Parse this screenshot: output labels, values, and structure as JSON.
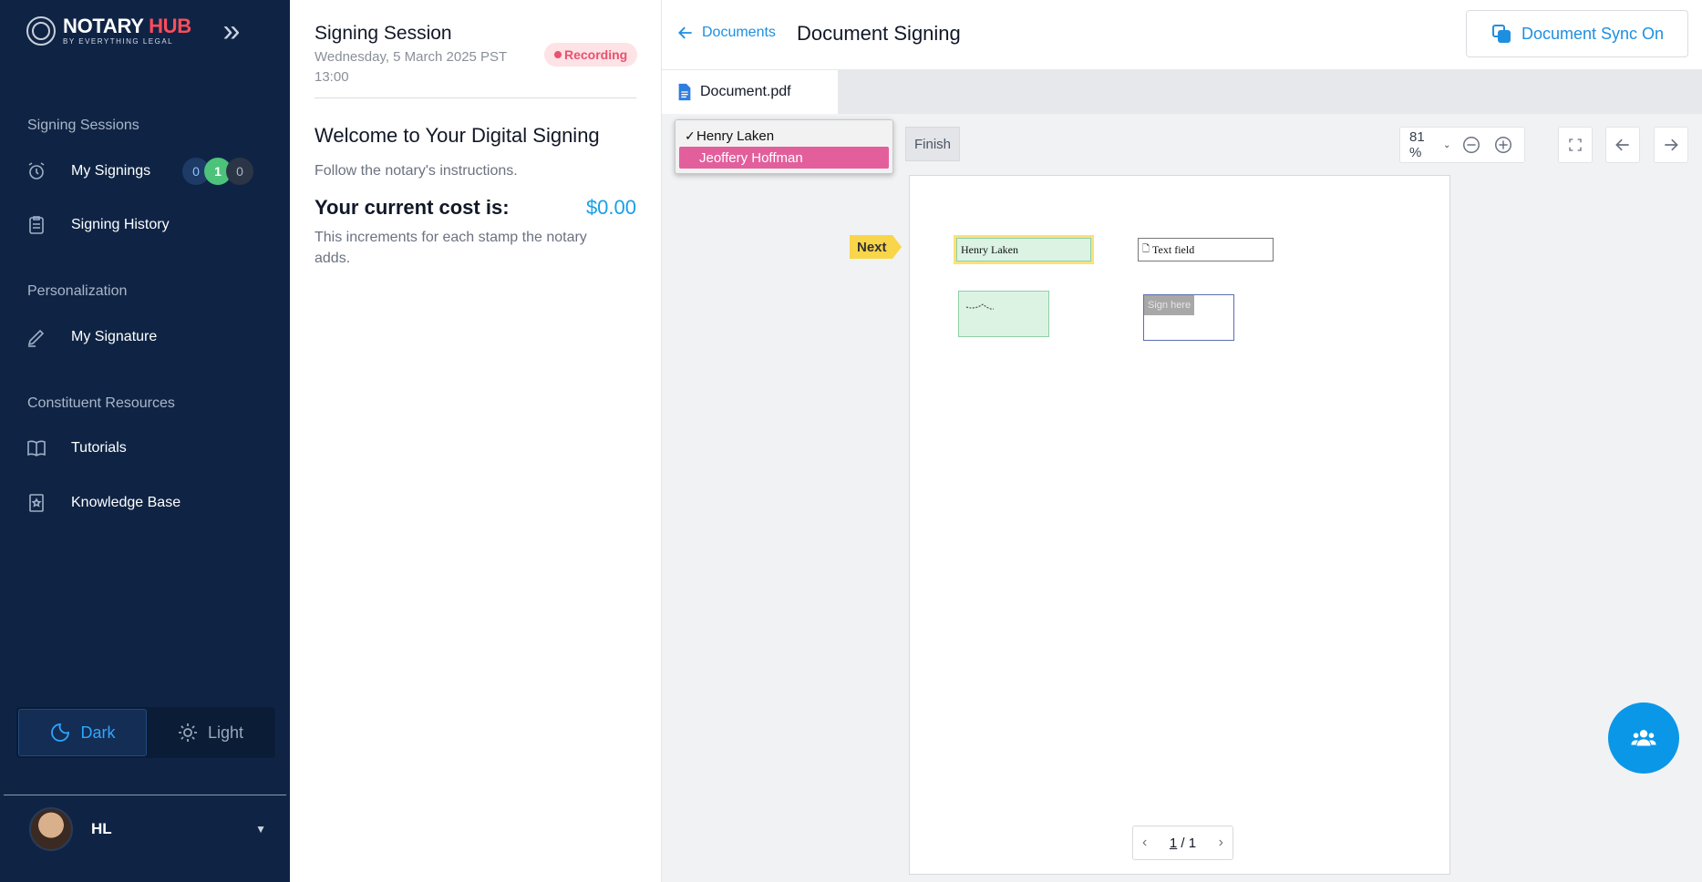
{
  "brand": {
    "name_part1": "NOTARY",
    "name_part2": "HUB",
    "tagline": "BY EVERYTHING LEGAL"
  },
  "sidebar": {
    "sections": [
      {
        "label": "Signing Sessions"
      },
      {
        "label": "Personalization"
      },
      {
        "label": "Constituent Resources"
      }
    ],
    "items": [
      {
        "label": "My Signings",
        "icon": "alarm-clock-icon"
      },
      {
        "label": "Signing History",
        "icon": "clipboard-icon"
      },
      {
        "label": "My Signature",
        "icon": "pen-icon"
      },
      {
        "label": "Tutorials",
        "icon": "book-icon"
      },
      {
        "label": "Knowledge Base",
        "icon": "bookmark-icon"
      }
    ],
    "signing_counts": [
      "0",
      "1",
      "0"
    ],
    "theme": {
      "dark_label": "Dark",
      "light_label": "Light",
      "active": "dark"
    },
    "user": {
      "initials": "HL"
    }
  },
  "session": {
    "title": "Signing Session",
    "date": "Wednesday, 5 March 2025   PST 13:00",
    "recording_label": "Recording",
    "welcome": "Welcome to Your Digital Signing",
    "instructions": "Follow the notary's instructions.",
    "cost_label": "Your current cost is:",
    "cost_value": "$0.00",
    "cost_note": "This increments for each stamp the notary adds."
  },
  "header": {
    "back_label": "Documents",
    "title": "Document Signing",
    "sync_label": "Document Sync On"
  },
  "tabs": [
    {
      "label": "Document.pdf"
    }
  ],
  "toolbar": {
    "finish_label": "Finish",
    "zoom": "81 %"
  },
  "signers": {
    "options": [
      {
        "name": "Henry Laken",
        "selected": true
      },
      {
        "name": "Jeoffery Hoffman",
        "highlighted": true
      }
    ]
  },
  "document": {
    "next_label": "Next",
    "name_field_value": "Henry Laken",
    "text_field_label": "Text field",
    "sign_here_label": "Sign here"
  },
  "pager": {
    "current": "1",
    "separator": "/",
    "total": "1"
  },
  "colors": {
    "sidebar_bg": "#0f2445",
    "accent": "#1e8fe0",
    "brand_red": "#ff4d5a",
    "recording": "#e8536d",
    "highlight_pink": "#e25f9c",
    "next_yellow": "#f9d54a",
    "fab": "#0a97e8"
  }
}
